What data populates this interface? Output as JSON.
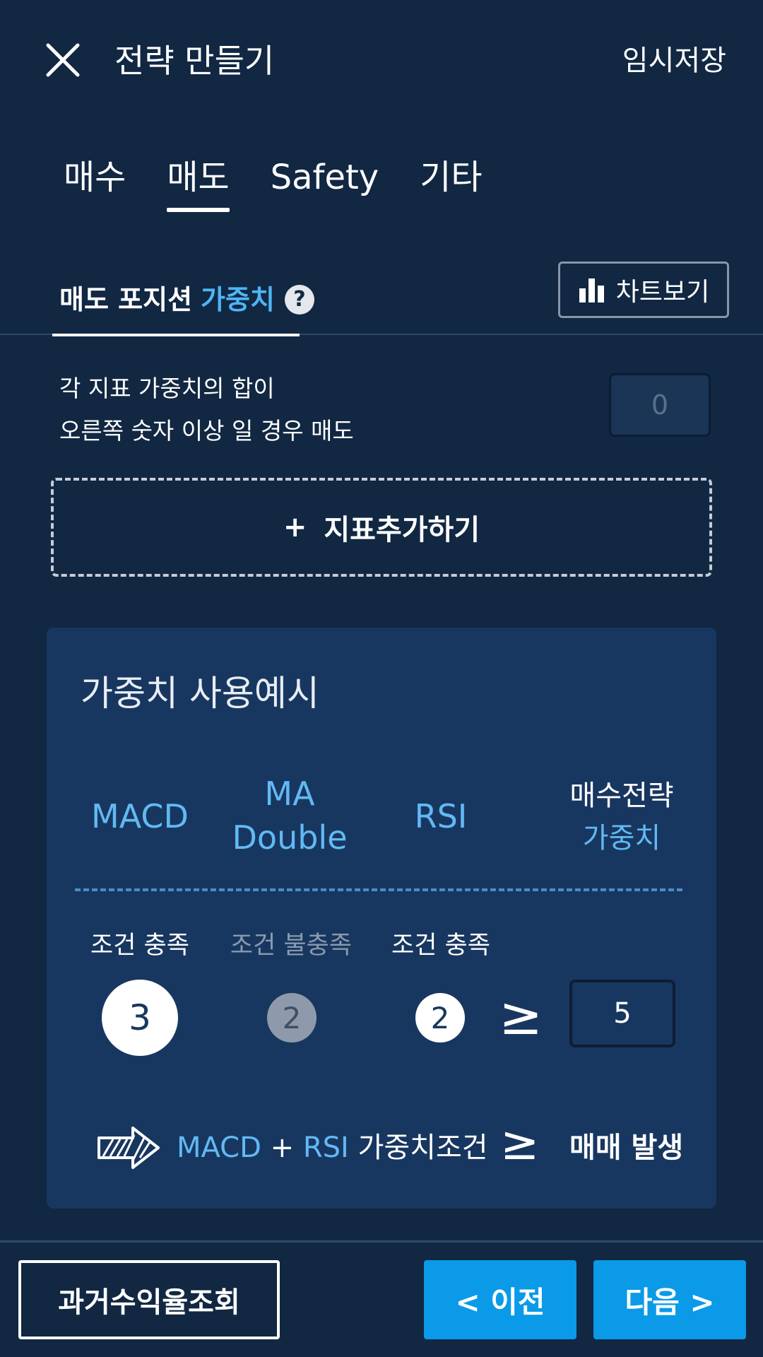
{
  "header": {
    "title": "전략 만들기",
    "temp_save": "임시저장",
    "close_icon": "close-icon"
  },
  "tabs": [
    {
      "label": "매수",
      "active": false
    },
    {
      "label": "매도",
      "active": true
    },
    {
      "label": "Safety",
      "active": false
    },
    {
      "label": "기타",
      "active": false
    }
  ],
  "section": {
    "title_main": "매도 포지션",
    "title_accent": "가중치",
    "help_glyph": "?",
    "chart_button": "차트보기"
  },
  "description": {
    "line1": "각 지표 가중치의 합이",
    "line2": "오른쪽 숫자 이상 일 경우 매도"
  },
  "threshold": {
    "placeholder": "0"
  },
  "add_indicator": {
    "plus": "+",
    "label": "지표추가하기"
  },
  "example": {
    "title": "가중치  사용예시",
    "columns": {
      "c1": "MACD",
      "c2_line1": "MA",
      "c2_line2": "Double",
      "c3": "RSI",
      "c4_line1": "매수전략",
      "c4_line2": "가중치"
    },
    "conditions": {
      "c1": "조건 충족",
      "c2": "조건 불충족",
      "c3": "조건 충족"
    },
    "weights": {
      "c1": "3",
      "c2": "2",
      "c3": "2",
      "target": "5"
    },
    "geq": "≥",
    "formula": {
      "macd": "MACD",
      "plus": "+",
      "rsi": "RSI",
      "text": "가중치조건",
      "result": "매매 발생"
    }
  },
  "footer": {
    "history": "과거수익율조회",
    "prev": "< 이전",
    "next": "다음 >"
  },
  "colors": {
    "background": "#112742",
    "accent": "#4fb5f3",
    "card": "#183760",
    "primary_button": "#0a9ae8"
  }
}
